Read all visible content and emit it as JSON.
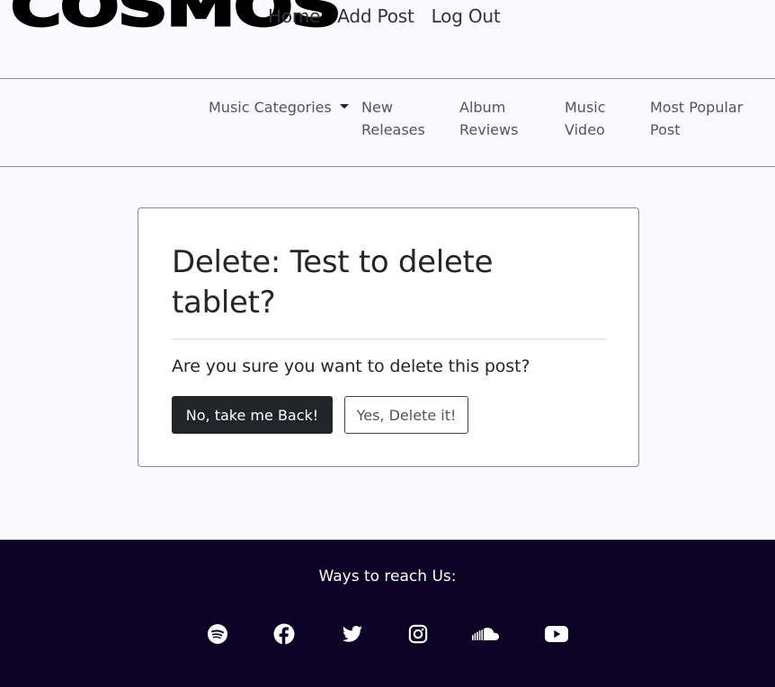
{
  "header": {
    "logo": "COSMOS",
    "nav": [
      {
        "label": "Home"
      },
      {
        "label": "Add Post"
      },
      {
        "label": "Log Out"
      }
    ]
  },
  "categories": {
    "dropdown_label": "Music Categories",
    "items": [
      {
        "label": "New Releases"
      },
      {
        "label": "Album Reviews"
      },
      {
        "label": "Music Video"
      },
      {
        "label": "Most Popular Post"
      }
    ]
  },
  "delete_card": {
    "title": "Delete: Test to delete tablet?",
    "question": "Are you sure you want to delete this post?",
    "back_label": "No, take me Back!",
    "confirm_label": "Yes, Delete it!"
  },
  "footer": {
    "heading": "Ways to reach Us:",
    "socials": [
      {
        "icon": "spotify-icon"
      },
      {
        "icon": "facebook-icon"
      },
      {
        "icon": "twitter-icon"
      },
      {
        "icon": "instagram-icon"
      },
      {
        "icon": "soundcloud-icon"
      },
      {
        "icon": "youtube-icon"
      }
    ]
  },
  "colors": {
    "page_background": "#fafafe",
    "footer_background": "#0b0326",
    "primary_button": "#212529"
  }
}
